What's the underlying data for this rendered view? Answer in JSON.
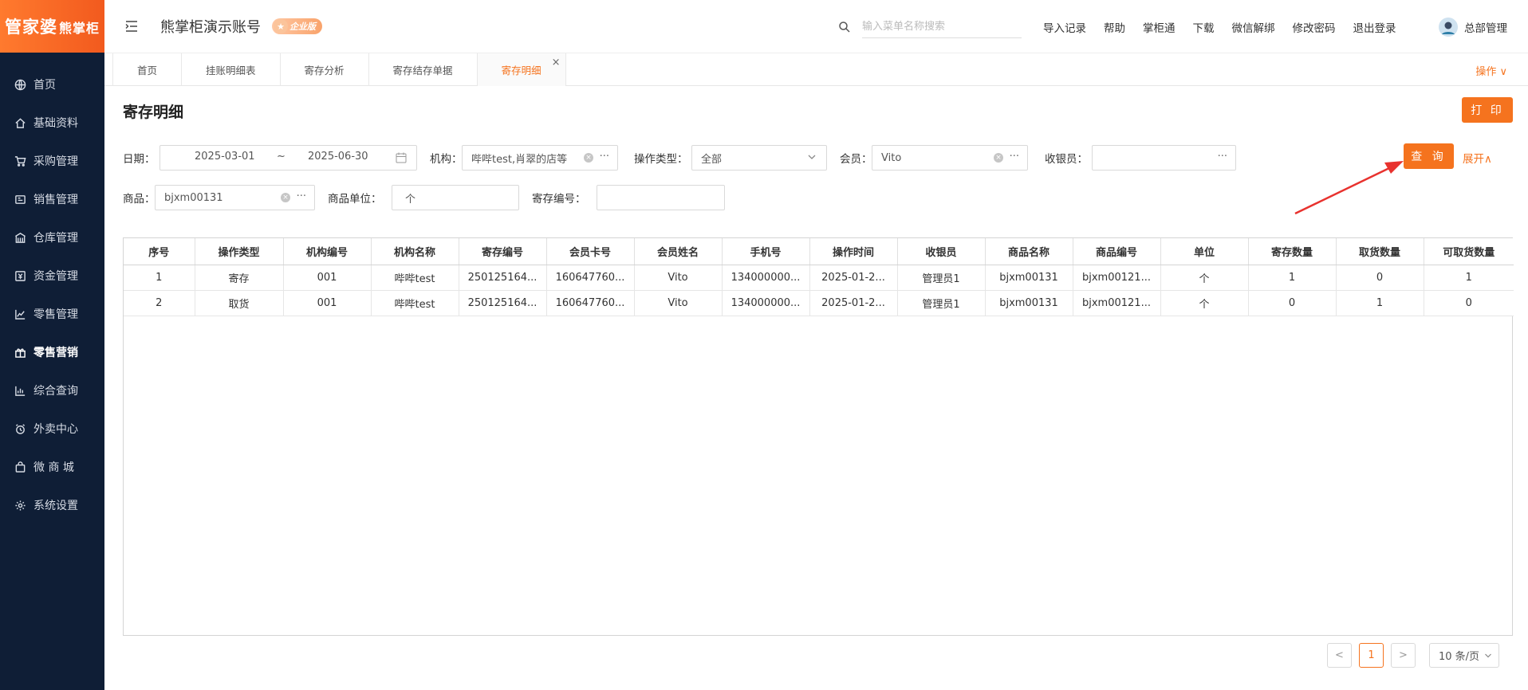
{
  "app": {
    "logo_main": "管家婆",
    "logo_sub": "熊掌柜",
    "account_name": "熊掌柜演示账号",
    "edition_badge": "企业版"
  },
  "sidebar": {
    "items": [
      {
        "label": "首页",
        "icon": "globe-icon"
      },
      {
        "label": "基础资料",
        "icon": "home-icon"
      },
      {
        "label": "采购管理",
        "icon": "cart-icon"
      },
      {
        "label": "销售管理",
        "icon": "sales-icon"
      },
      {
        "label": "仓库管理",
        "icon": "warehouse-icon"
      },
      {
        "label": "资金管理",
        "icon": "money-icon"
      },
      {
        "label": "零售管理",
        "icon": "retail-chart-icon"
      },
      {
        "label": "零售营销",
        "icon": "gift-icon"
      },
      {
        "label": "综合查询",
        "icon": "bar-chart-icon"
      },
      {
        "label": "外卖中心",
        "icon": "alarm-icon"
      },
      {
        "label": "微 商 城",
        "icon": "bag-icon"
      },
      {
        "label": "系统设置",
        "icon": "gear-icon"
      }
    ],
    "active": "零售营销"
  },
  "header": {
    "search_placeholder": "输入菜单名称搜索",
    "links": [
      "导入记录",
      "帮助",
      "掌柜通",
      "下载",
      "微信解绑",
      "修改密码",
      "退出登录"
    ],
    "user_name": "总部管理"
  },
  "tabs": {
    "items": [
      "首页",
      "挂账明细表",
      "寄存分析",
      "寄存结存单据",
      "寄存明细"
    ],
    "active": "寄存明细",
    "close_symbol": "×",
    "operations_label": "操作 ∨"
  },
  "page": {
    "title": "寄存明细",
    "print_label": "打 印"
  },
  "filters": {
    "date_label": "日期：",
    "date_start": "2025-03-01",
    "date_sep": "~",
    "date_end": "2025-06-30",
    "org_label": "机构：",
    "org_value": "哔哔test,肖翠的店等",
    "op_type_label": "操作类型：",
    "op_type_value": "全部",
    "member_label": "会员：",
    "member_value": "Vito",
    "cashier_label": "收银员：",
    "cashier_value": "",
    "product_label": "商品：",
    "product_value": "bjxm00131",
    "unit_label": "商品单位：",
    "unit_value": "个",
    "deposit_no_label": "寄存编号：",
    "deposit_no_value": "",
    "query_label": "查 询",
    "expand_label": "展开∧",
    "more_symbol": "···"
  },
  "table": {
    "columns": [
      "序号",
      "操作类型",
      "机构编号",
      "机构名称",
      "寄存编号",
      "会员卡号",
      "会员姓名",
      "手机号",
      "操作时间",
      "收银员",
      "商品名称",
      "商品编号",
      "单位",
      "寄存数量",
      "取货数量",
      "可取货数量"
    ],
    "rows": [
      [
        "1",
        "寄存",
        "001",
        "哔哔test",
        "250125164...",
        "160647760...",
        "Vito",
        "134000000...",
        "2025-01-2...",
        "管理员1",
        "bjxm00131",
        "bjxm00121...",
        "个",
        "1",
        "0",
        "1"
      ],
      [
        "2",
        "取货",
        "001",
        "哔哔test",
        "250125164...",
        "160647760...",
        "Vito",
        "134000000...",
        "2025-01-2...",
        "管理员1",
        "bjxm00131",
        "bjxm00121...",
        "个",
        "0",
        "1",
        "0"
      ]
    ]
  },
  "pagination": {
    "prev": "<",
    "current": "1",
    "next": ">",
    "page_size": "10 条/页"
  },
  "colors": {
    "accent": "#f5731e",
    "sidebar_bg": "#0f1e36",
    "annotation_arrow": "#e8322e"
  }
}
